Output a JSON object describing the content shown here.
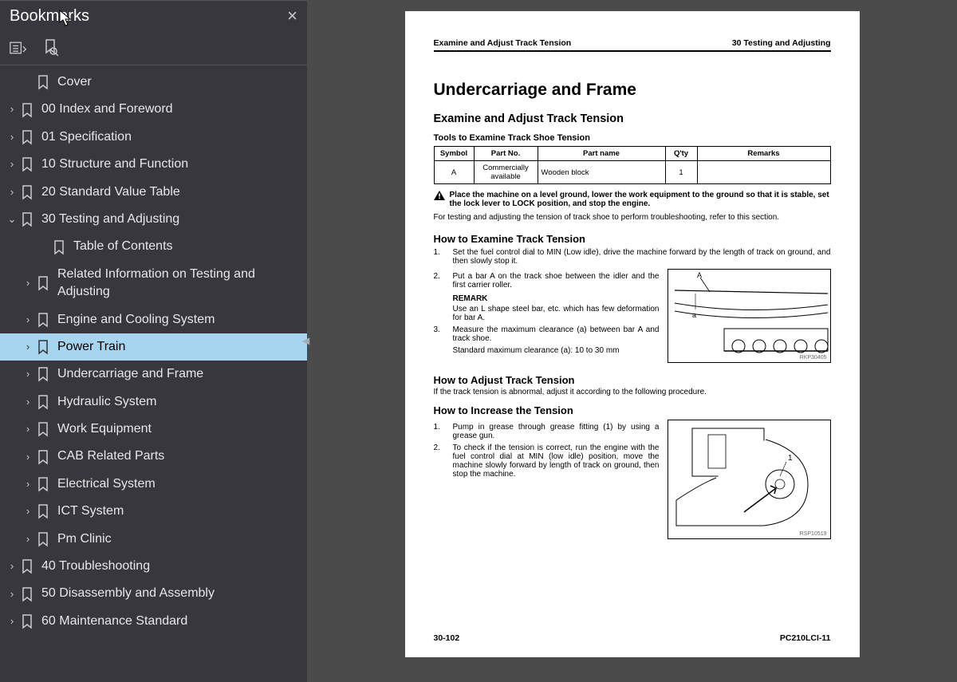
{
  "sidebar": {
    "title": "Bookmarks",
    "items": [
      {
        "label": "Cover",
        "depth": 1,
        "expandable": false
      },
      {
        "label": "00 Index and Foreword",
        "depth": 0,
        "expandable": true
      },
      {
        "label": "01 Specification",
        "depth": 0,
        "expandable": true
      },
      {
        "label": "10 Structure and Function",
        "depth": 0,
        "expandable": true
      },
      {
        "label": "20 Standard Value Table",
        "depth": 0,
        "expandable": true
      },
      {
        "label": "30 Testing and Adjusting",
        "depth": 0,
        "expandable": true,
        "expanded": true
      },
      {
        "label": "Table of Contents",
        "depth": 2,
        "expandable": false
      },
      {
        "label": "Related Information on Testing and Adjusting",
        "depth": 1,
        "expandable": true,
        "wrap": true
      },
      {
        "label": "Engine and Cooling System",
        "depth": 1,
        "expandable": true
      },
      {
        "label": "Power Train",
        "depth": 1,
        "expandable": true,
        "selected": true
      },
      {
        "label": "Undercarriage and Frame",
        "depth": 1,
        "expandable": true
      },
      {
        "label": "Hydraulic System",
        "depth": 1,
        "expandable": true
      },
      {
        "label": "Work Equipment",
        "depth": 1,
        "expandable": true
      },
      {
        "label": "CAB Related Parts",
        "depth": 1,
        "expandable": true
      },
      {
        "label": "Electrical System",
        "depth": 1,
        "expandable": true
      },
      {
        "label": "ICT System",
        "depth": 1,
        "expandable": true
      },
      {
        "label": "Pm Clinic",
        "depth": 1,
        "expandable": true
      },
      {
        "label": "40 Troubleshooting",
        "depth": 0,
        "expandable": true
      },
      {
        "label": "50 Disassembly and Assembly",
        "depth": 0,
        "expandable": true
      },
      {
        "label": "60 Maintenance Standard",
        "depth": 0,
        "expandable": true
      }
    ]
  },
  "page": {
    "running_left": "Examine and Adjust Track Tension",
    "running_right": "30 Testing and Adjusting",
    "title": "Undercarriage and Frame",
    "h2": "Examine and Adjust Track Tension",
    "h3": "Tools to Examine Track Shoe Tension",
    "table": {
      "headers": [
        "Symbol",
        "Part No.",
        "Part name",
        "Q'ty",
        "Remarks"
      ],
      "row": [
        "A",
        "Commercially available",
        "Wooden block",
        "1",
        ""
      ]
    },
    "warning": "Place the machine on a level ground, lower the work equipment to the ground so that it is stable, set the lock lever to LOCK position, and stop the engine.",
    "note1": "For testing and adjusting the tension of track shoe to perform troubleshooting, refer to this section.",
    "examine": {
      "heading": "How to Examine Track Tension",
      "step1": "Set the fuel control dial to MIN (Low idle), drive the machine forward by the length of track on ground, and then slowly stop it.",
      "step2": "Put a bar A on the track shoe between the idler and the first carrier roller.",
      "remark_label": "REMARK",
      "remark_text": "Use an L shape steel bar, etc. which has few deformation for bar A.",
      "step3": "Measure the maximum clearance (a) between bar A and track shoe.",
      "std": "Standard maximum clearance (a): 10 to 30 mm",
      "fig_id": "RKP30405"
    },
    "adjust_heading": "How to Adjust Track Tension",
    "adjust_note": "If the track tension is abnormal, adjust it according to the following procedure.",
    "increase": {
      "heading": "How to Increase the Tension",
      "step1": "Pump in grease through grease fitting (1) by using a grease gun.",
      "step2": "To check if the tension is correct, run the engine with the fuel control dial at MIN (low idle) position, move the machine slowly forward by length of track on ground, then stop the machine.",
      "fig_id": "RSP10519"
    },
    "footer_left": "30-102",
    "footer_right": "PC210LCI-11"
  }
}
